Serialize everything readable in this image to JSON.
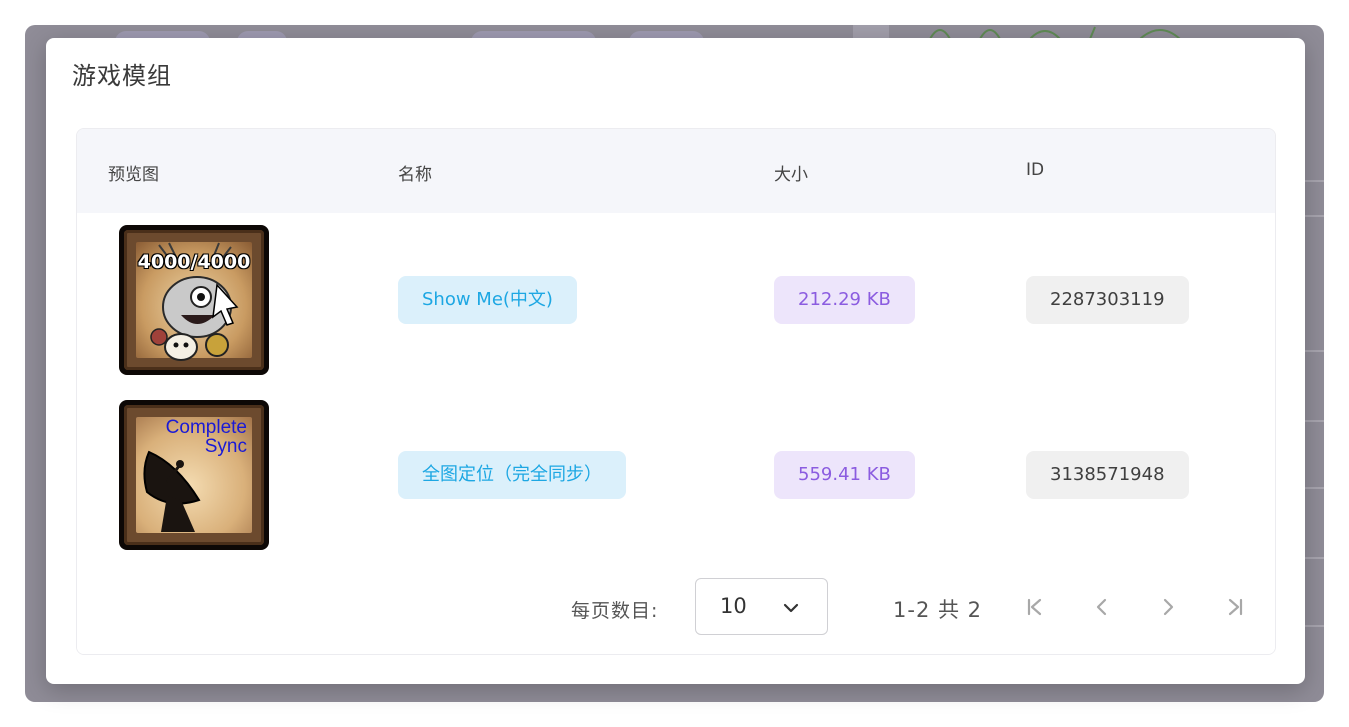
{
  "dialog": {
    "title": "游戏模组"
  },
  "table": {
    "headers": {
      "preview": "预览图",
      "name": "名称",
      "size": "大小",
      "id": "ID"
    },
    "rows": [
      {
        "thumb_text": "4000/4000",
        "name": "Show Me(中文)",
        "size": "212.29 KB",
        "id": "2287303119"
      },
      {
        "thumb_text_line1": "Complete",
        "thumb_text_line2": "Sync",
        "name": "全图定位（完全同步）",
        "size": "559.41 KB",
        "id": "3138571948"
      }
    ]
  },
  "pagination": {
    "per_page_label": "每页数目:",
    "per_page_value": "10",
    "range": "1-2 共 2"
  },
  "colors": {
    "name_tag_bg": "#dbf0fb",
    "name_tag_text": "#1da7e3",
    "size_tag_bg": "#ede5fb",
    "size_tag_text": "#8b5ce0",
    "id_tag_bg": "#f0f0f0"
  },
  "icons": {
    "select_arrow": "chevron-down-icon",
    "first_page": "first-page-icon",
    "prev_page": "chevron-left-icon",
    "next_page": "chevron-right-icon",
    "last_page": "last-page-icon"
  }
}
